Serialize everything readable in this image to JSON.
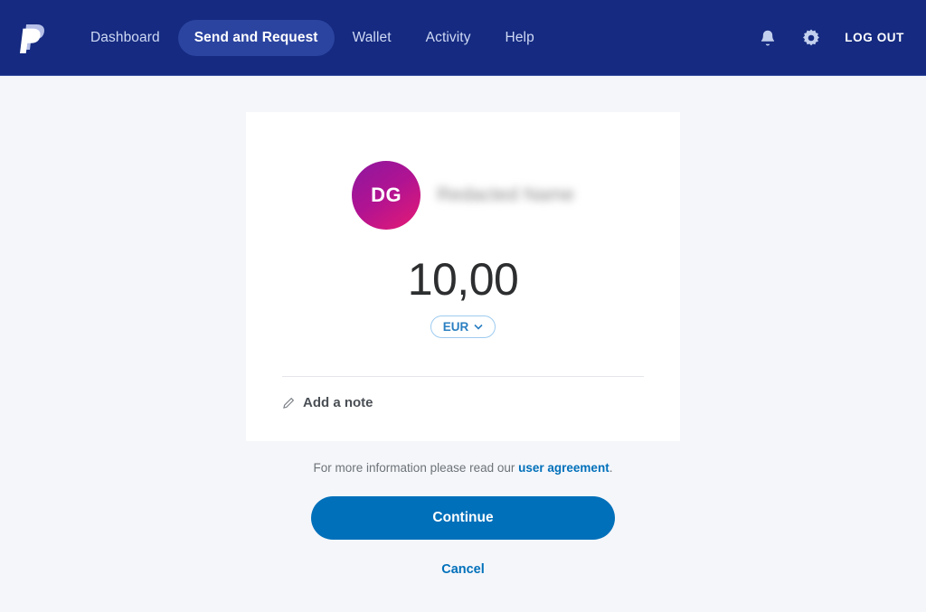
{
  "header": {
    "logo_icon": "paypal-logo-icon",
    "nav": [
      {
        "label": "Dashboard",
        "active": false
      },
      {
        "label": "Send and Request",
        "active": true
      },
      {
        "label": "Wallet",
        "active": false
      },
      {
        "label": "Activity",
        "active": false
      },
      {
        "label": "Help",
        "active": false
      }
    ],
    "notifications_icon": "bell-icon",
    "settings_icon": "gear-icon",
    "logout_label": "LOG OUT",
    "background_color": "#152a80",
    "active_pill_color": "#2b44a0"
  },
  "card": {
    "avatar_initials": "DG",
    "avatar_gradient_from": "#8d189f",
    "avatar_gradient_to": "#e61a74",
    "recipient_name": "Redacted Name",
    "amount": "10,00",
    "currency": "EUR",
    "currency_chevron_icon": "chevron-down-icon",
    "note_icon": "pencil-icon",
    "note_label": "Add a note"
  },
  "footer": {
    "legal_prefix": "For more information please read our ",
    "legal_link": "user agreement",
    "legal_suffix": ".",
    "continue_label": "Continue",
    "cancel_label": "Cancel",
    "accent_color": "#0070ba"
  }
}
